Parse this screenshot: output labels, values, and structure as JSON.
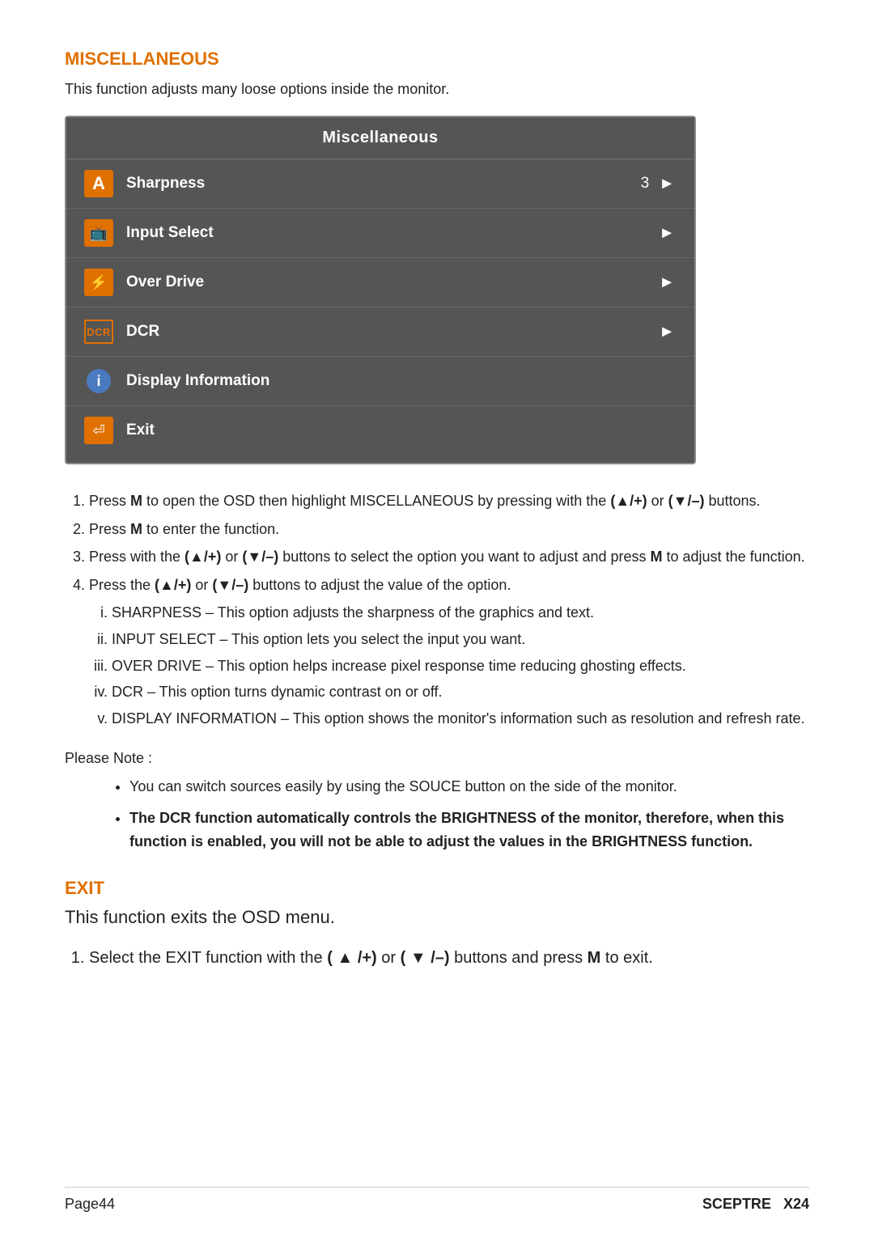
{
  "misc": {
    "heading": "MISCELLANEOUS",
    "intro": "This function adjusts many loose options inside the monitor.",
    "osd": {
      "title": "Miscellaneous",
      "rows": [
        {
          "id": "sharpness",
          "label": "Sharpness",
          "value": "3",
          "hasArrow": true,
          "iconType": "A"
        },
        {
          "id": "input-select",
          "label": "Input Select",
          "value": "",
          "hasArrow": true,
          "iconType": "input"
        },
        {
          "id": "over-drive",
          "label": "Over Drive",
          "value": "",
          "hasArrow": true,
          "iconType": "overdrive"
        },
        {
          "id": "dcr",
          "label": "DCR",
          "value": "",
          "hasArrow": true,
          "iconType": "dcr"
        },
        {
          "id": "display-info",
          "label": "Display Information",
          "value": "",
          "hasArrow": false,
          "iconType": "info"
        },
        {
          "id": "exit",
          "label": "Exit",
          "value": "",
          "hasArrow": false,
          "iconType": "exit"
        }
      ]
    },
    "instructions": [
      "Press M to open the OSD then highlight MISCELLANEOUS by pressing with the (▲/+) or (▼/–) buttons.",
      "Press M to enter the function.",
      "Press with the (▲/+) or (▼/–) buttons to select the option you want to adjust and press M to adjust the function.",
      "Press the (▲/+) or (▼/–) buttons to adjust the value of the option."
    ],
    "sub_instructions": [
      "SHARPNESS – This option adjusts the sharpness of the graphics and text.",
      "INPUT SELECT – This option lets you select the input you want.",
      "OVER DRIVE – This option helps increase pixel response time reducing ghosting effects.",
      "DCR – This option turns dynamic contrast on or off.",
      "DISPLAY INFORMATION – This option shows the monitor's information such as resolution and refresh rate."
    ],
    "please_note_label": "Please Note :",
    "notes": [
      "You can switch sources easily by using the SOUCE button on the side of the monitor.",
      "The DCR function automatically controls the BRIGHTNESS of the monitor, therefore, when this function is enabled, you will not be able to adjust the values in the BRIGHTNESS function."
    ]
  },
  "exit": {
    "heading": "EXIT",
    "intro": "This function exits the OSD menu.",
    "instruction": "Select the EXIT function with the ( ▲ /+) or ( ▼ /–) buttons and press M to exit."
  },
  "footer": {
    "page": "Page44",
    "brand": "SCEPTRE",
    "model": "X24"
  }
}
